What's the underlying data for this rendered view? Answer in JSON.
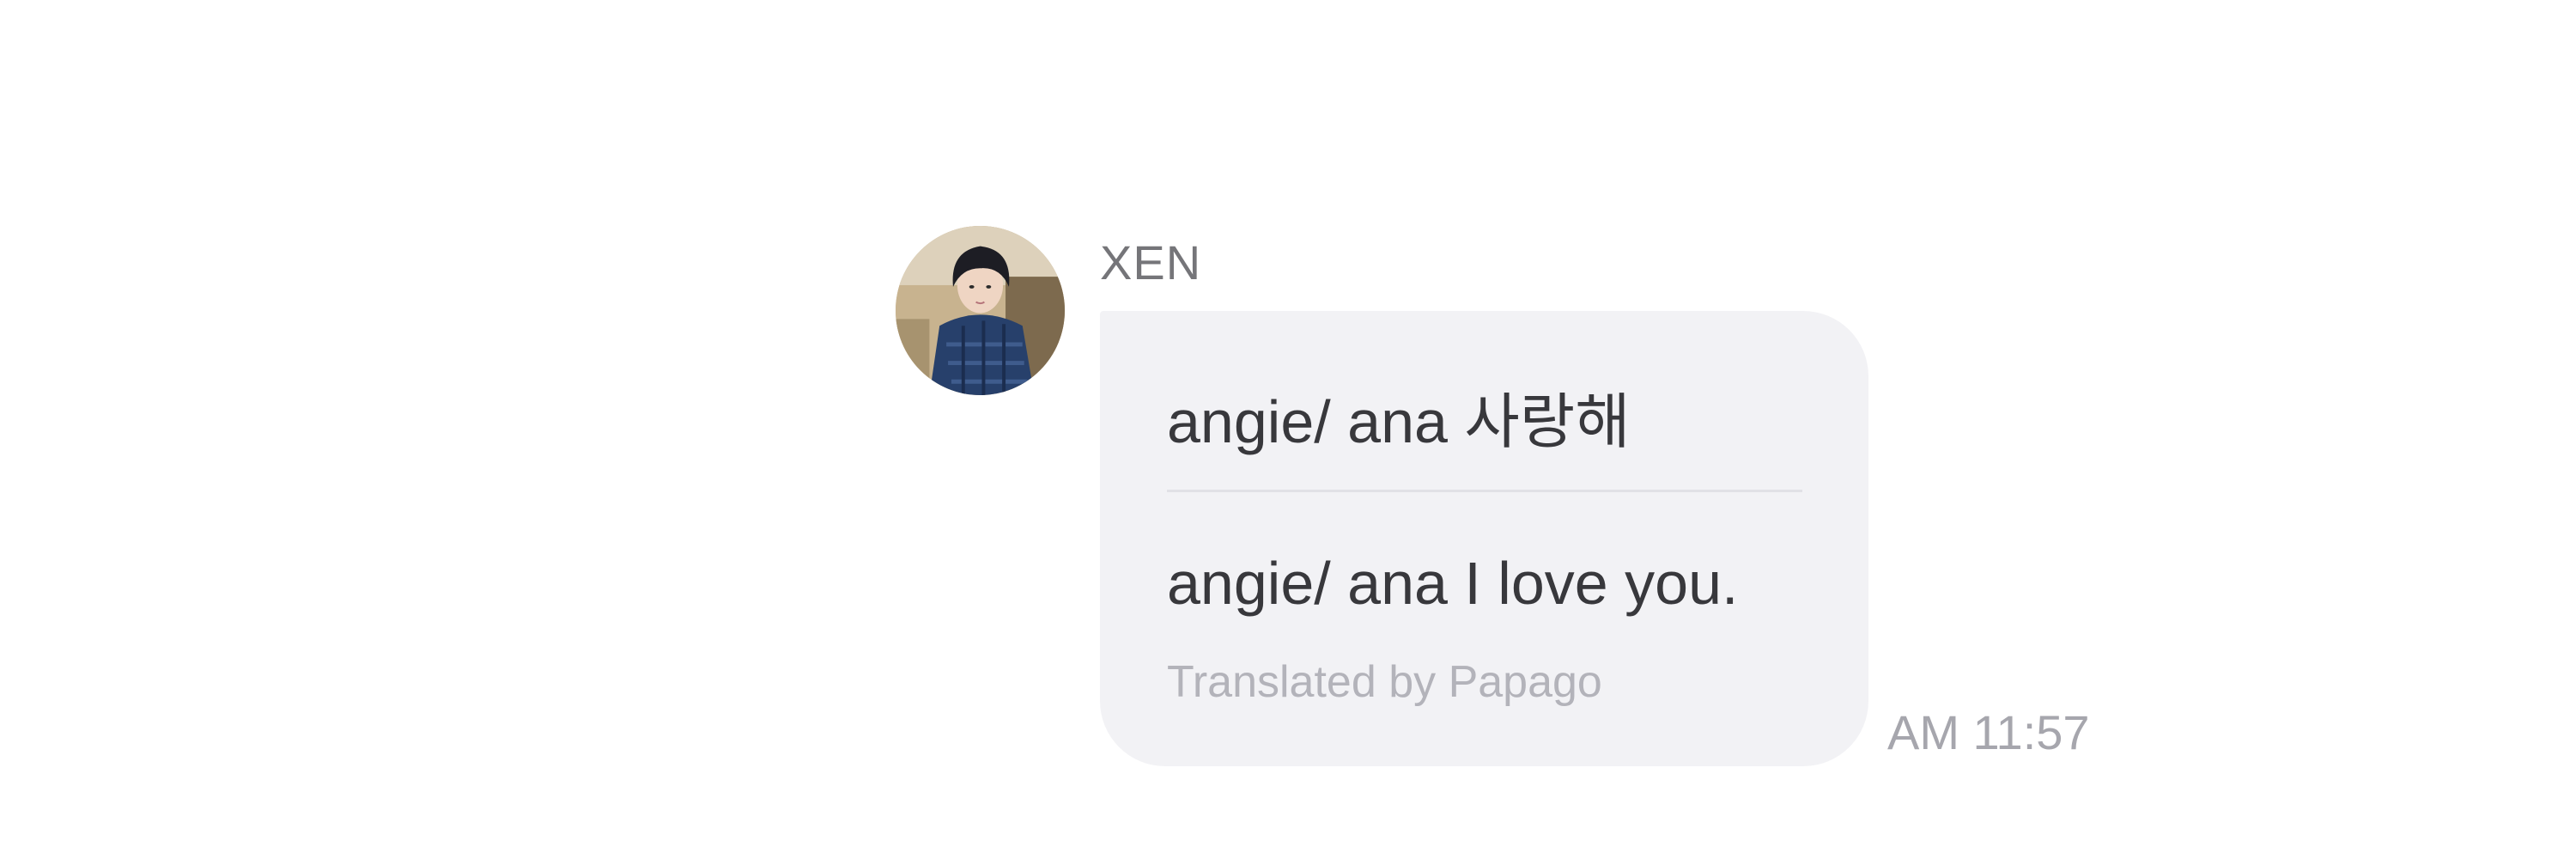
{
  "message": {
    "sender": "XEN",
    "original_text": "angie/ ana 사랑해",
    "translated_text": "angie/ ana I love you.",
    "translation_credit": "Translated by Papago",
    "time": "AM 11:57",
    "avatar_icon": "profile-photo"
  },
  "colors": {
    "bubble_background": "#f2f2f5",
    "message_text": "#38383c",
    "muted_text": "#a6a6ad"
  }
}
